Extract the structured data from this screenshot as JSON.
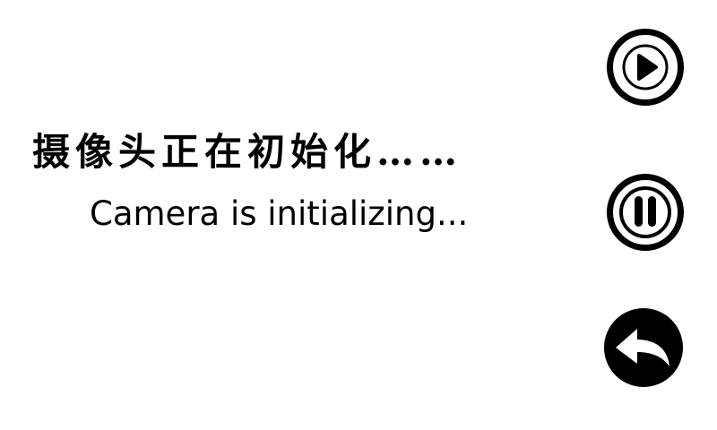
{
  "status": {
    "message_zh": "摄像头正在初始化……",
    "message_en": "Camera is initializing..."
  },
  "controls": {
    "play_icon": "play-icon",
    "pause_icon": "pause-icon",
    "back_icon": "back-arrow-icon"
  },
  "colors": {
    "background": "#ffffff",
    "foreground": "#000000"
  }
}
